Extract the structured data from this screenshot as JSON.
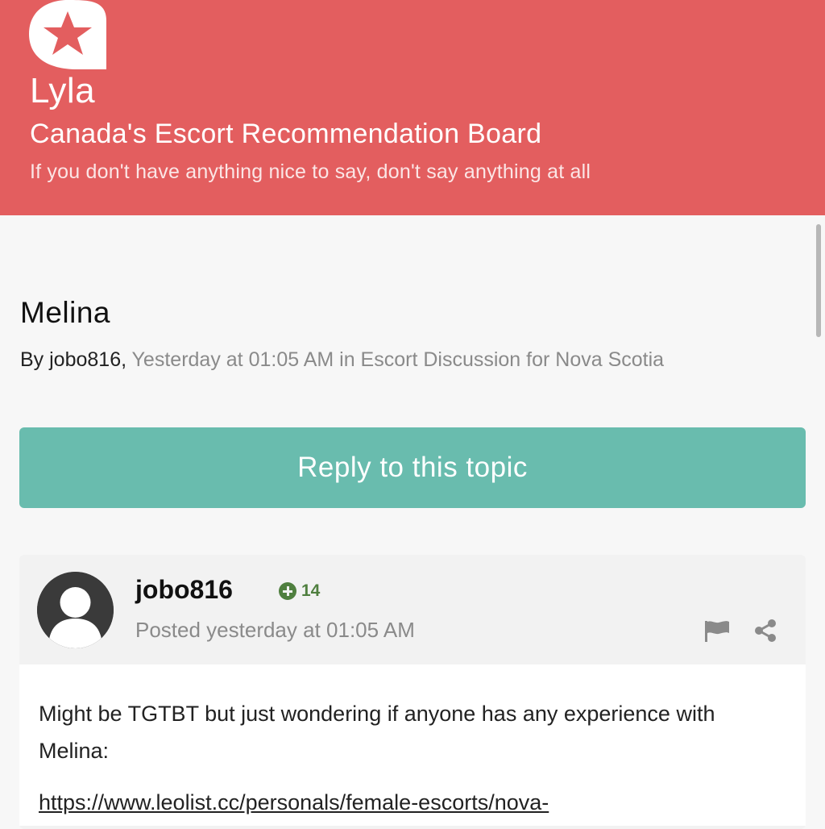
{
  "header": {
    "brand": "Lyla",
    "board_title": "Canada's Escort Recommendation Board",
    "tagline": "If you don't have anything nice to say, don't say anything at all",
    "logo_icon": "star-bubble-icon",
    "background_color": "#e35e5f"
  },
  "topic": {
    "title": "Melina",
    "meta_prefix": "By ",
    "author": "jobo816,",
    "meta_rest": " Yesterday at 01:05 AM in Escort Discussion for Nova Scotia"
  },
  "reply_button": {
    "label": "Reply to this topic",
    "color": "#69bcae"
  },
  "post": {
    "username": "jobo816",
    "reputation": "14",
    "posted": "Posted yesterday at 01:05 AM",
    "body": "Might be TGTBT but just wondering if anyone has any experience with Melina:",
    "link": "https://www.leolist.cc/personals/female-escorts/nova-",
    "icons": [
      "avatar-icon",
      "reputation-plus-icon",
      "flag-icon",
      "share-icon"
    ]
  }
}
